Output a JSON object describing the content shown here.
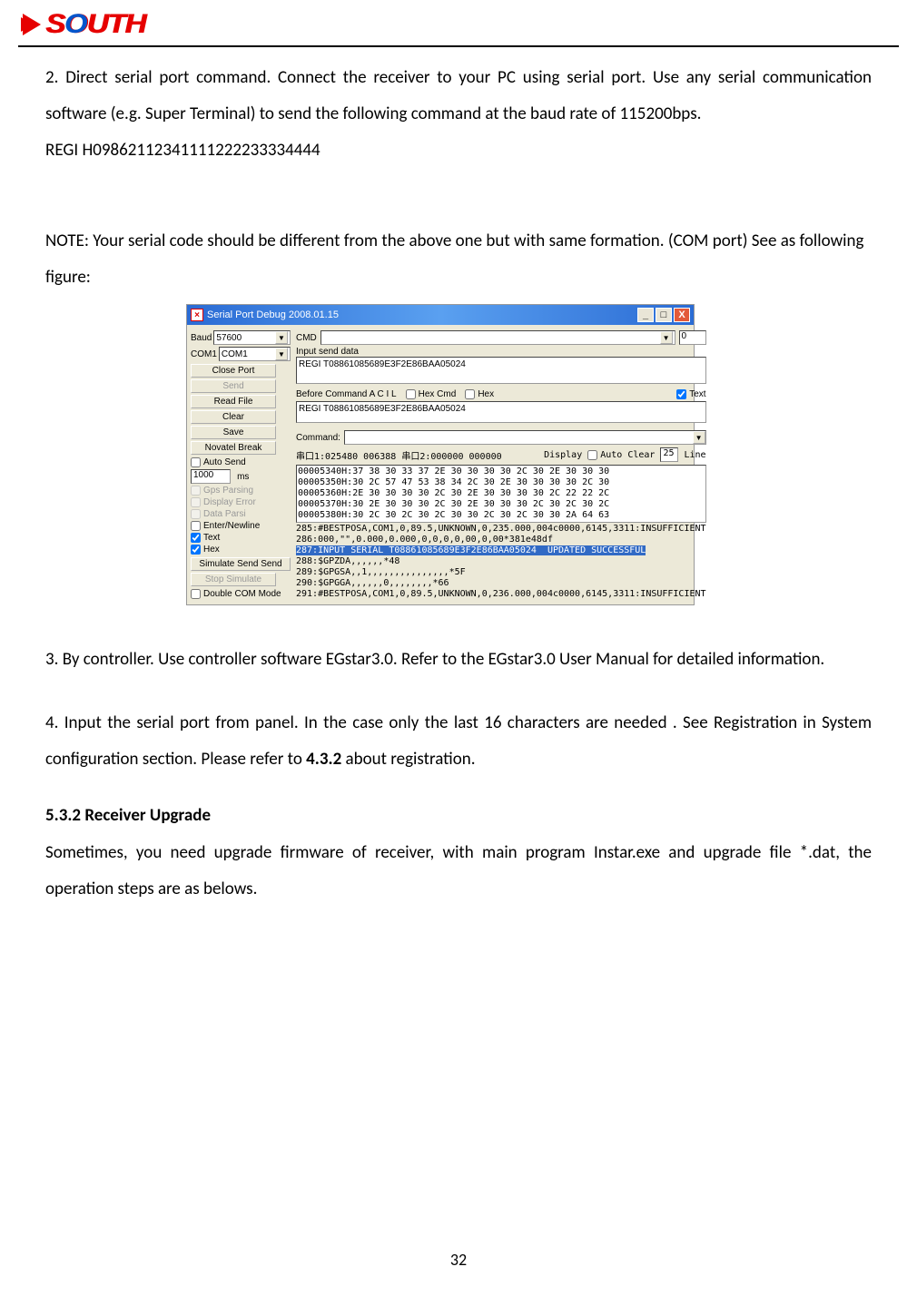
{
  "logo": {
    "text_part1": "S",
    "text_part2": "O",
    "text_part3": "UTH"
  },
  "para1": "2. Direct serial port command. Connect the receiver to your PC using serial port. Use any serial communication software (e.g. Super Terminal) to send the following command at the baud rate of 115200bps.",
  "cmd_line": "REGI H09862112341111222233334444",
  "note_line": "NOTE: Your serial code should be different from the above one but with same formation. (COM port) See as following figure:",
  "app": {
    "title": "Serial Port Debug 2008.01.15",
    "titlebar_icon": "×",
    "left": {
      "baud_label": "Baud",
      "baud_value": "57600",
      "com_label": "COM1",
      "com_value": "COM1",
      "btn_close": "Close Port",
      "btn_send": "Send",
      "btn_read": "Read File",
      "btn_clear": "Clear",
      "btn_save": "Save",
      "btn_novatel": "Novatel Break",
      "chk_auto": "Auto Send",
      "ms_value": "1000",
      "ms_label": "ms",
      "chk_gps": "Gps Parsing",
      "chk_disp_err": "Display Error",
      "chk_data_parsi": "Data Parsi",
      "chk_enter": "Enter/Newline",
      "chk_text": "Text",
      "chk_hex": "Hex",
      "btn_sim_send": "Simulate Send Send",
      "btn_stop_sim": "Stop Simulate",
      "chk_double": "Double COM Mode"
    },
    "right": {
      "cmd_label": "CMD",
      "zero": "0",
      "input_label": "Input send data",
      "input_value": "REGI T08861085689E3F2E86BAA05024",
      "before_label": "Before Command A  C  I  L",
      "hex_cmd": "Hex Cmd",
      "hex": "Hex",
      "text": "Text",
      "output_value": "REGI T08861085689E3F2E86BAA05024",
      "command_label": "Command:",
      "status": "串口1:025480 006388 串口2:000000 000000",
      "display": "Display",
      "auto_clear": "Auto Clear",
      "ac_value": "25",
      "line": "Line",
      "hex_dump": "00005340H:37 38 30 33 37 2E 30 30 30 30 2C 30 2E 30 30 30\n00005350H:30 2C 57 47 53 38 34 2C 30 2E 30 30 30 30 2C 30\n00005360H:2E 30 30 30 30 2C 30 2E 30 30 30 30 2C 22 22 2C\n00005370H:30 2E 30 30 30 2C 30 2E 30 30 30 2C 30 2C 30 2C\n00005380H:30 2C 30 2C 30 2C 30 30 2C 30 2C 30 30 2A 64 63",
      "log_line1": "285:#BESTPOSA,COM1,0,89.5,UNKNOWN,0,235.000,004c0000,6145,3311:INSUFFICIENT",
      "log_line2": "286:000,\"\",0.000,0.000,0,0,0,0,00,0,00*381e48df",
      "log_line3_sel": "287:INPUT SERIAL T08861085689E3F2E86BAA05024  UPDATED SUCCESSFUL",
      "log_line4": "288:$GPZDA,,,,,,*48",
      "log_line5": "289:$GPGSA,,1,,,,,,,,,,,,,,,*5F",
      "log_line6": "290:$GPGGA,,,,,,0,,,,,,,,*66",
      "log_line7": "291:#BESTPOSA,COM1,0,89.5,UNKNOWN,0,236.000,004c0000,6145,3311:INSUFFICIENT"
    }
  },
  "para3": "3. By controller. Use controller software EGstar3.0. Refer to the EGstar3.0 User Manual for detailed information.",
  "para4_a": "4. Input the serial port from panel. In the case only the last 16 characters are needed . See Registration in System configuration section. Please refer to ",
  "para4_bold": "4.3.2",
  "para4_b": " about registration.",
  "heading": "5.3.2 Receiver Upgrade",
  "para5": "Sometimes, you need upgrade firmware of receiver, with main program Instar.exe and upgrade file *.dat, the operation steps are as belows.",
  "page_num": "32"
}
